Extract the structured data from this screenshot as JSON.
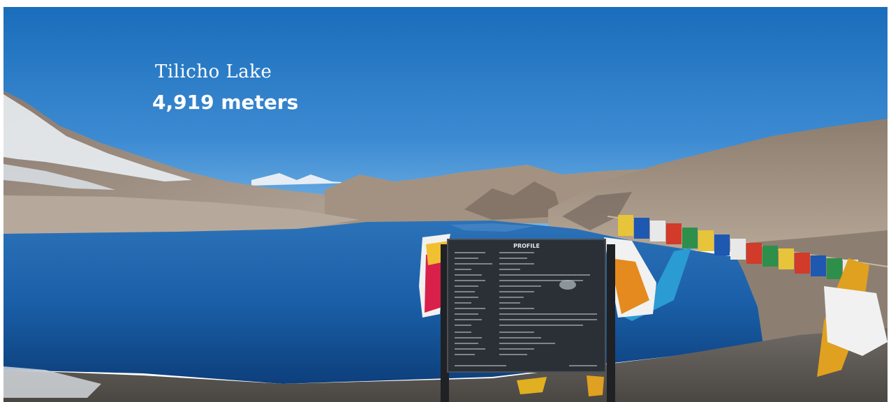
{
  "caption": {
    "title": "Tilicho Lake",
    "elevation": "4,919 meters"
  },
  "sign": {
    "heading": "PROFILE"
  },
  "colors": {
    "sky_top": "#1a6dbb",
    "sky_horizon": "#5fa6e0",
    "lake": "#1a5fa8",
    "lake_deep": "#0d3f7c",
    "mountain": "#9a8a7c",
    "snow": "#e9eef3",
    "sign_board": "#2a3035",
    "caption_text": "#ffffff"
  },
  "icons": [
    "prayer-flags-icon",
    "information-sign-icon"
  ]
}
